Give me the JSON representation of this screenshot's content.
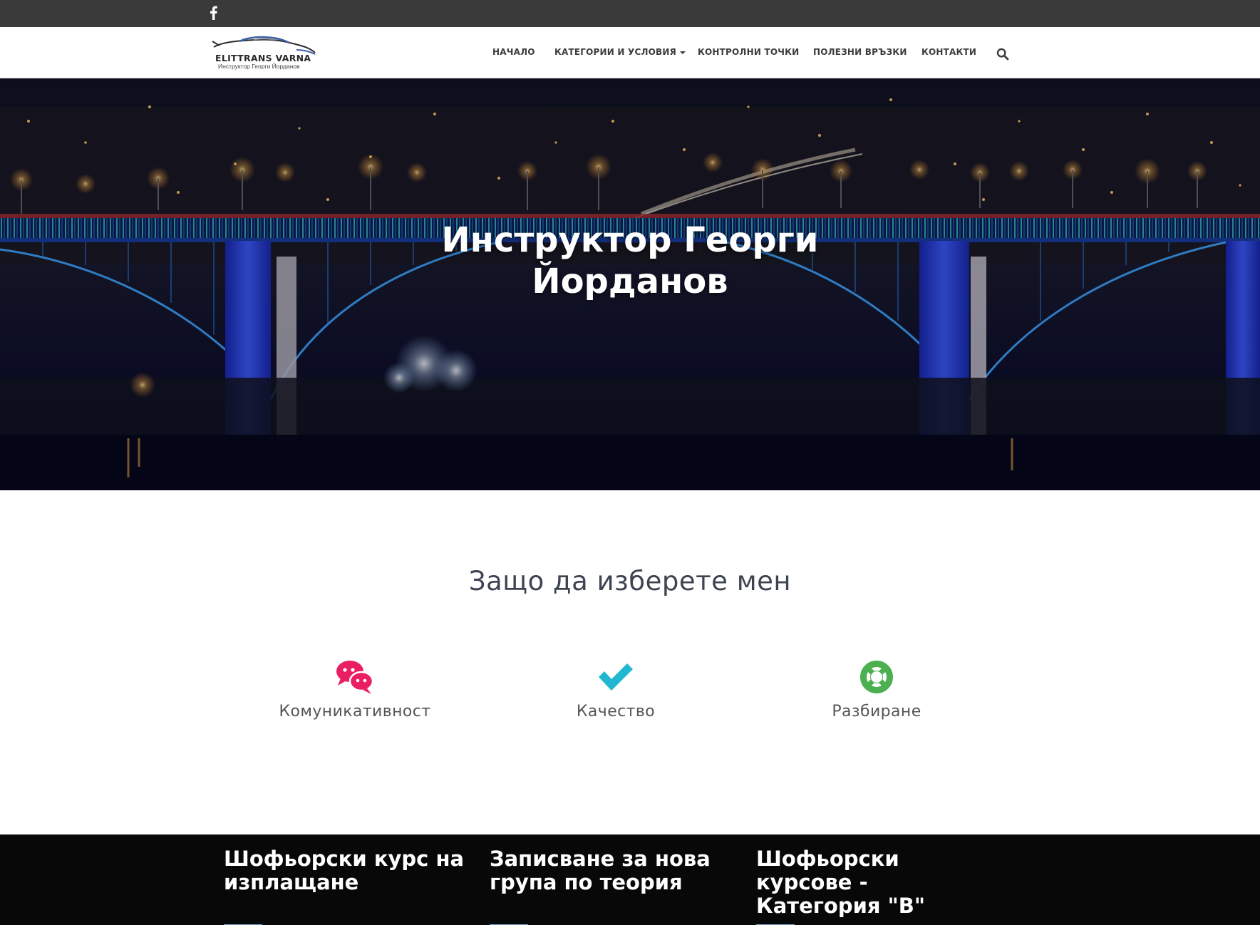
{
  "topbar": {
    "social": [
      {
        "icon": "facebook-icon"
      }
    ]
  },
  "logo": {
    "name": "ELITTRANS VARNA",
    "subtitle": "Инструктор Георги Йорданов"
  },
  "nav": {
    "items": [
      {
        "label": "НАЧАЛО"
      },
      {
        "label": "КАТЕГОРИИ И УСЛОВИЯ",
        "has_dropdown": true
      },
      {
        "label": "КОНТРОЛНИ ТОЧКИ"
      },
      {
        "label": "ПОЛЕЗНИ ВРЪЗКИ"
      },
      {
        "label": "КОНТАКТИ"
      }
    ],
    "search_icon": "search-icon"
  },
  "hero": {
    "title": "Инструктор Георги Йорданов"
  },
  "features": {
    "title": "Защо да изберете мен",
    "items": [
      {
        "label": "Комуникативност",
        "icon": "chat-bubbles-icon",
        "color": "#e91e63"
      },
      {
        "label": "Качество",
        "icon": "checkmark-icon",
        "color": "#1fb8d0"
      },
      {
        "label": "Разбиране",
        "icon": "lifebuoy-icon",
        "color": "#4caf50"
      }
    ]
  },
  "band": {
    "items": [
      {
        "title": "Шофьорски курс на изплащане"
      },
      {
        "title": "Записване за нова група по теория"
      },
      {
        "title": "Шофьорски курсове - Категория \"В\""
      }
    ],
    "accent": "#7fa7d1"
  },
  "colors": {
    "topbar": "#3a3a3a",
    "band": "#080808",
    "heading": "#3d4451"
  }
}
